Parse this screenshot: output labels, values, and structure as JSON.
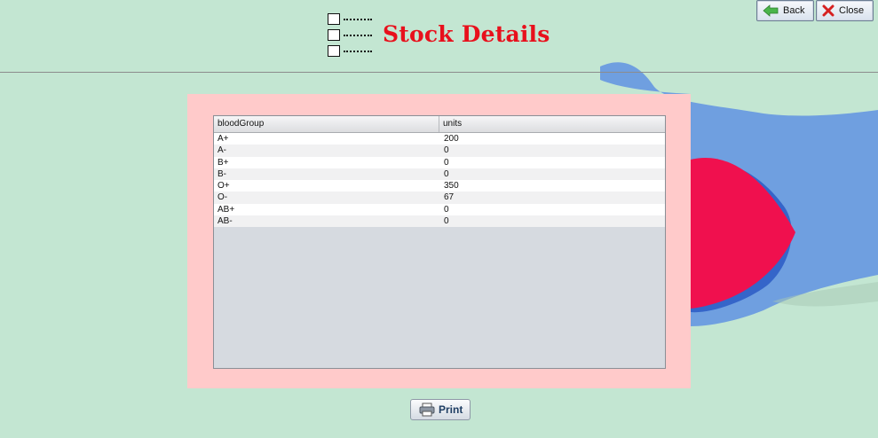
{
  "page": {
    "title": "Stock Details"
  },
  "toolbar": {
    "back_label": "Back",
    "close_label": "Close"
  },
  "table": {
    "columns": [
      "bloodGroup",
      "units"
    ],
    "rows": [
      [
        "A+",
        "200"
      ],
      [
        "A-",
        "0"
      ],
      [
        "B+",
        "0"
      ],
      [
        "B-",
        "0"
      ],
      [
        "O+",
        "350"
      ],
      [
        "O-",
        "67"
      ],
      [
        "AB+",
        "0"
      ],
      [
        "AB-",
        "0"
      ]
    ]
  },
  "footer": {
    "print_label": "Print"
  },
  "colors": {
    "title": "#e8101c",
    "panel": "#ffcaca",
    "background": "#c3e6d2",
    "accent_blue": "#6f9fe0",
    "accent_red": "#f0104e"
  }
}
